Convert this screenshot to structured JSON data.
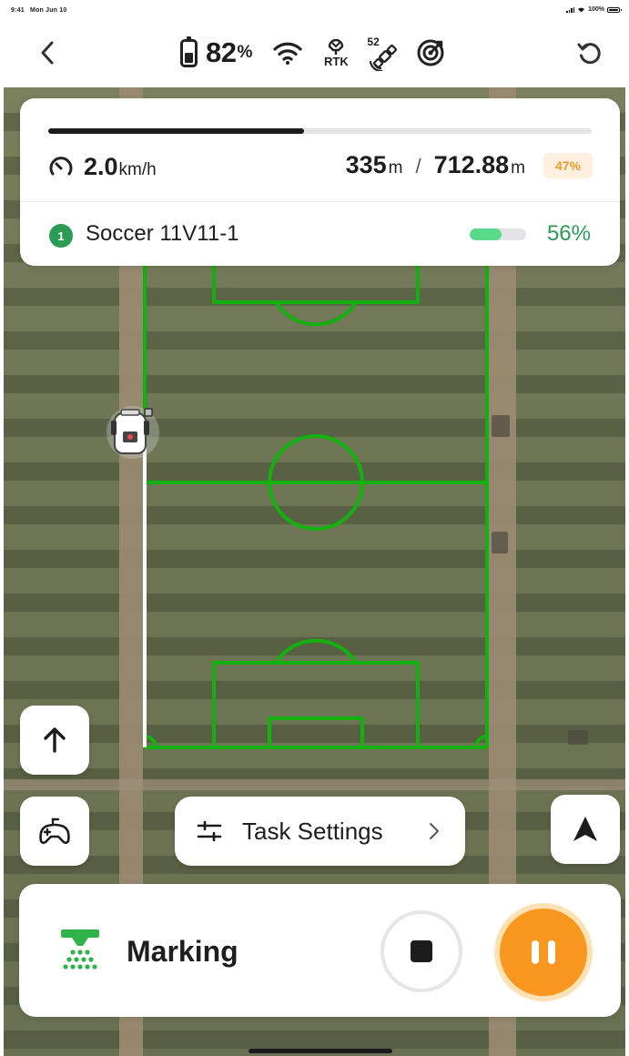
{
  "status_bar": {
    "time": "9:41",
    "date": "Mon Jun 10",
    "battery_text": "100%"
  },
  "top_bar": {
    "back_icon": "chevron-left-icon",
    "battery_value": "82",
    "battery_unit": "%",
    "wifi_icon": "wifi-icon",
    "rtk_label": "RTK",
    "satellite_count": "52",
    "satellite_icon": "satellite-icon",
    "target_icon": "target-icon",
    "refresh_icon": "refresh-icon"
  },
  "progress": {
    "overall_fraction": 0.47,
    "speed_value": "2.0",
    "speed_unit": "km/h",
    "distance_done": "335",
    "distance_done_unit": "m",
    "separator": "/",
    "distance_total": "712.88",
    "distance_total_unit": "m",
    "percent_badge": "47%",
    "task": {
      "index": "1",
      "name": "Soccer 11V11-1",
      "percent": "56%",
      "fraction": 0.56
    }
  },
  "controls": {
    "direction_icon": "arrow-up-icon",
    "remote_icon": "gamepad-icon",
    "task_settings_label": "Task Settings",
    "task_settings_icon": "sliders-icon",
    "navigate_icon": "navigation-arrow-icon"
  },
  "bottom": {
    "mode_label": "Marking",
    "mode_icon": "spray-marking-icon",
    "stop_icon": "stop-icon",
    "pause_icon": "pause-icon"
  },
  "colors": {
    "accent_orange": "#f7971f",
    "success_green": "#2b9a55",
    "field_line": "#13b10f",
    "badge_bg": "#fdf0de"
  }
}
